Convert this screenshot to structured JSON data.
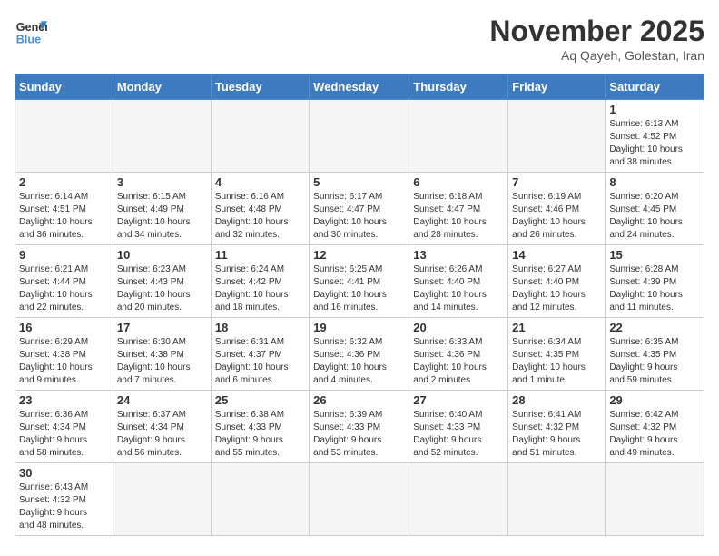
{
  "header": {
    "logo_general": "General",
    "logo_blue": "Blue",
    "month": "November 2025",
    "location": "Aq Qayeh, Golestan, Iran"
  },
  "days_of_week": [
    "Sunday",
    "Monday",
    "Tuesday",
    "Wednesday",
    "Thursday",
    "Friday",
    "Saturday"
  ],
  "weeks": [
    [
      {
        "day": "",
        "info": ""
      },
      {
        "day": "",
        "info": ""
      },
      {
        "day": "",
        "info": ""
      },
      {
        "day": "",
        "info": ""
      },
      {
        "day": "",
        "info": ""
      },
      {
        "day": "",
        "info": ""
      },
      {
        "day": "1",
        "info": "Sunrise: 6:13 AM\nSunset: 4:52 PM\nDaylight: 10 hours\nand 38 minutes."
      }
    ],
    [
      {
        "day": "2",
        "info": "Sunrise: 6:14 AM\nSunset: 4:51 PM\nDaylight: 10 hours\nand 36 minutes."
      },
      {
        "day": "3",
        "info": "Sunrise: 6:15 AM\nSunset: 4:49 PM\nDaylight: 10 hours\nand 34 minutes."
      },
      {
        "day": "4",
        "info": "Sunrise: 6:16 AM\nSunset: 4:48 PM\nDaylight: 10 hours\nand 32 minutes."
      },
      {
        "day": "5",
        "info": "Sunrise: 6:17 AM\nSunset: 4:47 PM\nDaylight: 10 hours\nand 30 minutes."
      },
      {
        "day": "6",
        "info": "Sunrise: 6:18 AM\nSunset: 4:47 PM\nDaylight: 10 hours\nand 28 minutes."
      },
      {
        "day": "7",
        "info": "Sunrise: 6:19 AM\nSunset: 4:46 PM\nDaylight: 10 hours\nand 26 minutes."
      },
      {
        "day": "8",
        "info": "Sunrise: 6:20 AM\nSunset: 4:45 PM\nDaylight: 10 hours\nand 24 minutes."
      }
    ],
    [
      {
        "day": "9",
        "info": "Sunrise: 6:21 AM\nSunset: 4:44 PM\nDaylight: 10 hours\nand 22 minutes."
      },
      {
        "day": "10",
        "info": "Sunrise: 6:23 AM\nSunset: 4:43 PM\nDaylight: 10 hours\nand 20 minutes."
      },
      {
        "day": "11",
        "info": "Sunrise: 6:24 AM\nSunset: 4:42 PM\nDaylight: 10 hours\nand 18 minutes."
      },
      {
        "day": "12",
        "info": "Sunrise: 6:25 AM\nSunset: 4:41 PM\nDaylight: 10 hours\nand 16 minutes."
      },
      {
        "day": "13",
        "info": "Sunrise: 6:26 AM\nSunset: 4:40 PM\nDaylight: 10 hours\nand 14 minutes."
      },
      {
        "day": "14",
        "info": "Sunrise: 6:27 AM\nSunset: 4:40 PM\nDaylight: 10 hours\nand 12 minutes."
      },
      {
        "day": "15",
        "info": "Sunrise: 6:28 AM\nSunset: 4:39 PM\nDaylight: 10 hours\nand 11 minutes."
      }
    ],
    [
      {
        "day": "16",
        "info": "Sunrise: 6:29 AM\nSunset: 4:38 PM\nDaylight: 10 hours\nand 9 minutes."
      },
      {
        "day": "17",
        "info": "Sunrise: 6:30 AM\nSunset: 4:38 PM\nDaylight: 10 hours\nand 7 minutes."
      },
      {
        "day": "18",
        "info": "Sunrise: 6:31 AM\nSunset: 4:37 PM\nDaylight: 10 hours\nand 6 minutes."
      },
      {
        "day": "19",
        "info": "Sunrise: 6:32 AM\nSunset: 4:36 PM\nDaylight: 10 hours\nand 4 minutes."
      },
      {
        "day": "20",
        "info": "Sunrise: 6:33 AM\nSunset: 4:36 PM\nDaylight: 10 hours\nand 2 minutes."
      },
      {
        "day": "21",
        "info": "Sunrise: 6:34 AM\nSunset: 4:35 PM\nDaylight: 10 hours\nand 1 minute."
      },
      {
        "day": "22",
        "info": "Sunrise: 6:35 AM\nSunset: 4:35 PM\nDaylight: 9 hours\nand 59 minutes."
      }
    ],
    [
      {
        "day": "23",
        "info": "Sunrise: 6:36 AM\nSunset: 4:34 PM\nDaylight: 9 hours\nand 58 minutes."
      },
      {
        "day": "24",
        "info": "Sunrise: 6:37 AM\nSunset: 4:34 PM\nDaylight: 9 hours\nand 56 minutes."
      },
      {
        "day": "25",
        "info": "Sunrise: 6:38 AM\nSunset: 4:33 PM\nDaylight: 9 hours\nand 55 minutes."
      },
      {
        "day": "26",
        "info": "Sunrise: 6:39 AM\nSunset: 4:33 PM\nDaylight: 9 hours\nand 53 minutes."
      },
      {
        "day": "27",
        "info": "Sunrise: 6:40 AM\nSunset: 4:33 PM\nDaylight: 9 hours\nand 52 minutes."
      },
      {
        "day": "28",
        "info": "Sunrise: 6:41 AM\nSunset: 4:32 PM\nDaylight: 9 hours\nand 51 minutes."
      },
      {
        "day": "29",
        "info": "Sunrise: 6:42 AM\nSunset: 4:32 PM\nDaylight: 9 hours\nand 49 minutes."
      }
    ],
    [
      {
        "day": "30",
        "info": "Sunrise: 6:43 AM\nSunset: 4:32 PM\nDaylight: 9 hours\nand 48 minutes."
      },
      {
        "day": "",
        "info": ""
      },
      {
        "day": "",
        "info": ""
      },
      {
        "day": "",
        "info": ""
      },
      {
        "day": "",
        "info": ""
      },
      {
        "day": "",
        "info": ""
      },
      {
        "day": "",
        "info": ""
      }
    ]
  ]
}
